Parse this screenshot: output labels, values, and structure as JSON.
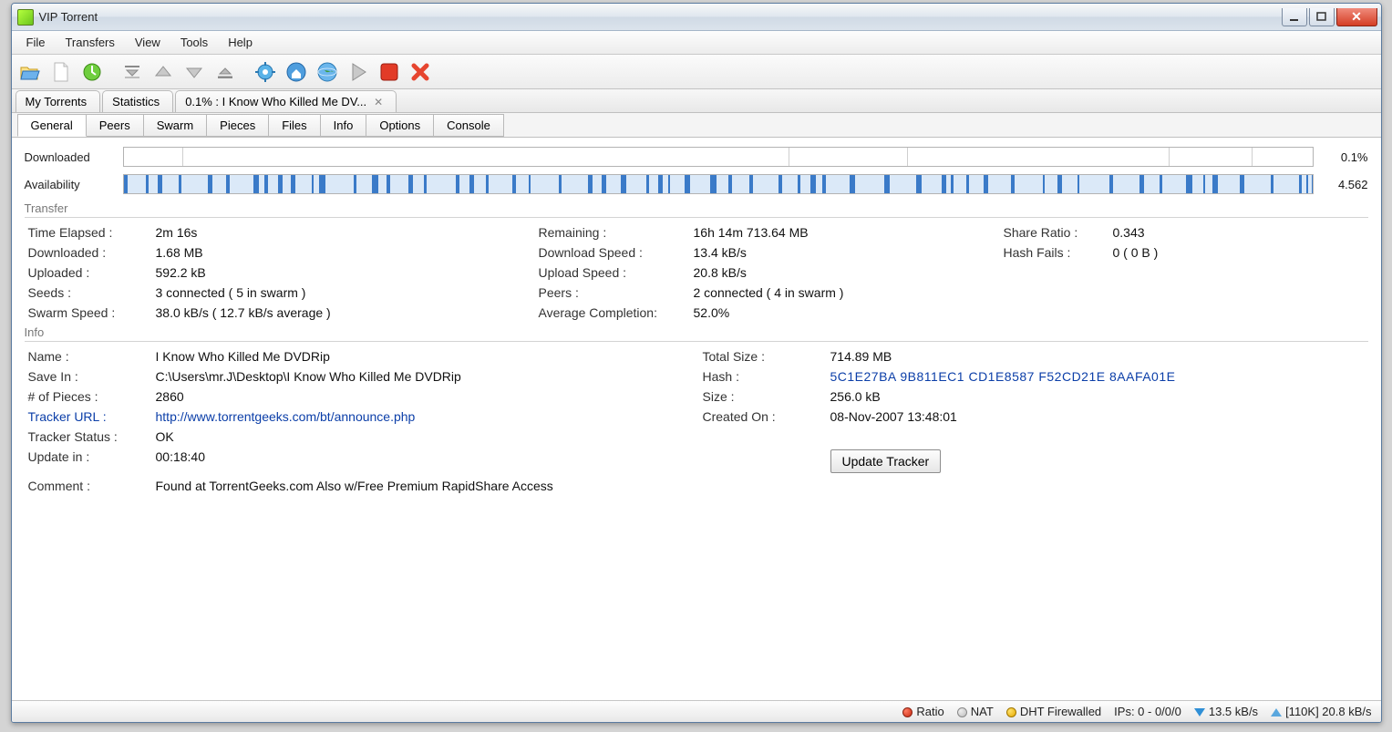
{
  "window": {
    "title": "VIP Torrent"
  },
  "menu": {
    "items": [
      "File",
      "Transfers",
      "View",
      "Tools",
      "Help"
    ]
  },
  "toolbar_icons": [
    "open-icon",
    "new-icon",
    "url-icon",
    "queue-top-icon",
    "queue-up-icon",
    "queue-down-icon",
    "queue-bottom-icon",
    "settings-icon",
    "home-icon",
    "globe-icon",
    "play-icon",
    "stop-icon",
    "delete-icon"
  ],
  "top_tabs": [
    {
      "label": "My Torrents",
      "close": false
    },
    {
      "label": "Statistics",
      "close": false
    },
    {
      "label": "0.1% : I Know Who Killed Me DV...",
      "close": true
    }
  ],
  "sub_tabs": [
    "General",
    "Peers",
    "Swarm",
    "Pieces",
    "Files",
    "Info",
    "Options",
    "Console"
  ],
  "bars": {
    "downloaded_label": "Downloaded",
    "downloaded_value": "0.1%",
    "availability_label": "Availability",
    "availability_value": "4.562"
  },
  "transfer": {
    "title": "Transfer",
    "time_elapsed_l": "Time Elapsed :",
    "time_elapsed_v": "2m 16s",
    "remaining_l": "Remaining :",
    "remaining_v": "16h 14m 713.64 MB",
    "share_ratio_l": "Share Ratio :",
    "share_ratio_v": "0.343",
    "downloaded_l": "Downloaded :",
    "downloaded_v": "1.68 MB",
    "dl_speed_l": "Download Speed :",
    "dl_speed_v": "13.4 kB/s",
    "hash_fails_l": "Hash Fails :",
    "hash_fails_v": "0 ( 0 B )",
    "uploaded_l": "Uploaded :",
    "uploaded_v": "592.2 kB",
    "ul_speed_l": "Upload Speed :",
    "ul_speed_v": "20.8 kB/s",
    "seeds_l": "Seeds :",
    "seeds_v": "3 connected ( 5 in swarm )",
    "peers_l": "Peers :",
    "peers_v": "2 connected ( 4 in swarm )",
    "swarm_speed_l": "Swarm Speed :",
    "swarm_speed_v": "38.0 kB/s ( 12.7 kB/s average )",
    "avg_comp_l": "Average Completion:",
    "avg_comp_v": "52.0%"
  },
  "info": {
    "title": "Info",
    "name_l": "Name :",
    "name_v": "I Know Who Killed Me DVDRip",
    "total_size_l": "Total Size :",
    "total_size_v": "714.89 MB",
    "save_in_l": "Save In :",
    "save_in_v": "C:\\Users\\mr.J\\Desktop\\I Know Who Killed Me DVDRip",
    "hash_l": "Hash :",
    "hash_v": "5C1E27BA 9B811EC1 CD1E8587 F52CD21E 8AAFA01E",
    "pieces_l": "# of Pieces :",
    "pieces_v": "2860",
    "size_l": "Size :",
    "size_v": "256.0 kB",
    "tracker_url_l": "Tracker URL :",
    "tracker_url_v": "http://www.torrentgeeks.com/bt/announce.php",
    "created_l": "Created On :",
    "created_v": "08-Nov-2007 13:48:01",
    "tracker_status_l": "Tracker Status :",
    "tracker_status_v": "OK",
    "update_in_l": "Update in :",
    "update_in_v": "00:18:40",
    "update_btn": "Update Tracker",
    "comment_l": "Comment :",
    "comment_v": "Found at TorrentGeeks.com Also w/Free Premium RapidShare Access"
  },
  "status": {
    "ratio": "Ratio",
    "nat": "NAT",
    "dht": "DHT Firewalled",
    "ips": "IPs: 0 - 0/0/0",
    "down": "13.5 kB/s",
    "up": "[110K] 20.8 kB/s"
  }
}
